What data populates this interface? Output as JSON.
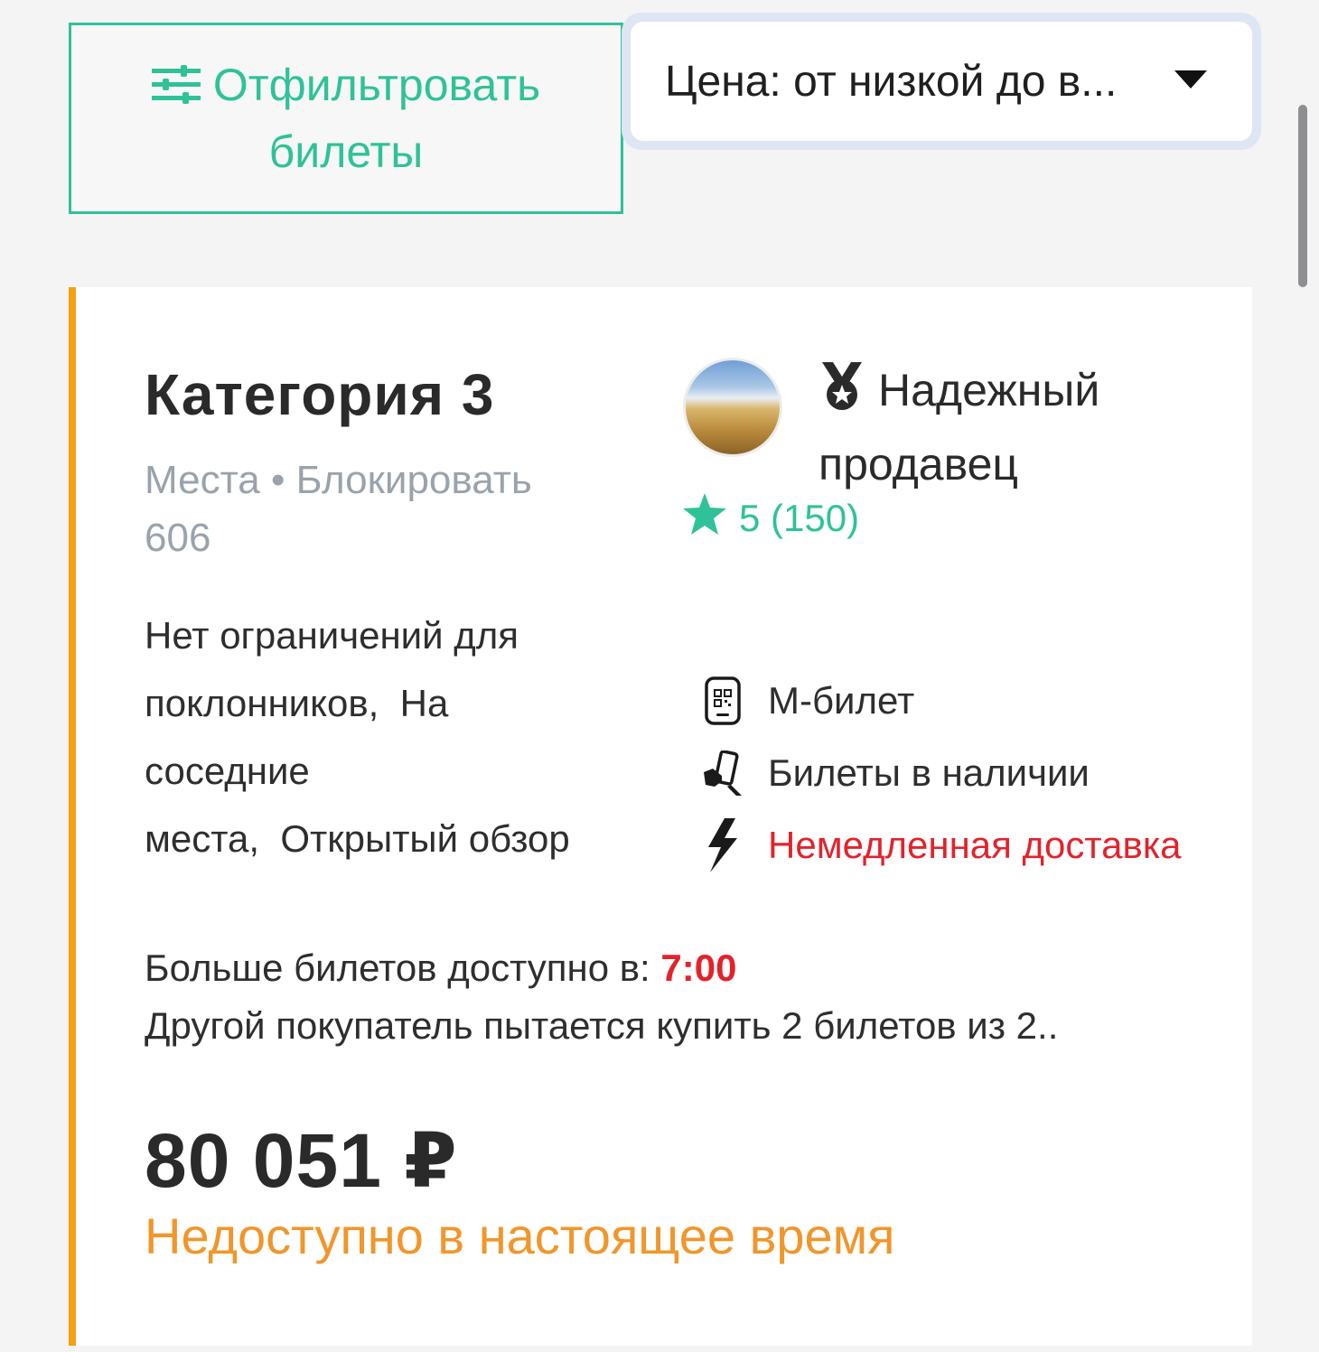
{
  "toolbar": {
    "filter_button": {
      "label_line1": "Отфильтровать",
      "label_line2": "билеты",
      "icon": "sliders-icon"
    },
    "sort_select": {
      "selected": "Цена: от низкой до в...",
      "icon": "caret-down-icon"
    }
  },
  "ticket": {
    "category": "Категория 3",
    "seats_line1": "Места • Блокировать",
    "seats_line2": "606",
    "seller": {
      "badge_line1": "Надежный",
      "badge_line2": "продавец",
      "badge_icon": "medal-icon",
      "rating": "5 (150)",
      "rating_icon": "star-icon",
      "avatar": "seller-avatar"
    },
    "features_text": {
      "line1": "Нет ограничений для",
      "line2": "поклонников,  На",
      "line3": "соседние",
      "line4": "места,  Открытый обзор"
    },
    "features": [
      {
        "label": "М-билет",
        "icon": "mobile-ticket-icon"
      },
      {
        "label": "Билеты в наличии",
        "icon": "hand-ticket-icon"
      },
      {
        "label": "Немедленная доставка",
        "icon": "lightning-icon",
        "color": "#e2232c"
      }
    ],
    "availability": {
      "prefix": "Больше билетов доступно в: ",
      "time": "7:00",
      "other_buyer": "Другой покупатель пытается купить 2 билетов из 2.."
    },
    "price": "80 051 ₽",
    "status": "Недоступно в настоящее время",
    "colors": {
      "accent": "#2fc298",
      "stripe": "#f5a00f",
      "warning": "#f0962b",
      "alert": "#e2232c"
    }
  }
}
